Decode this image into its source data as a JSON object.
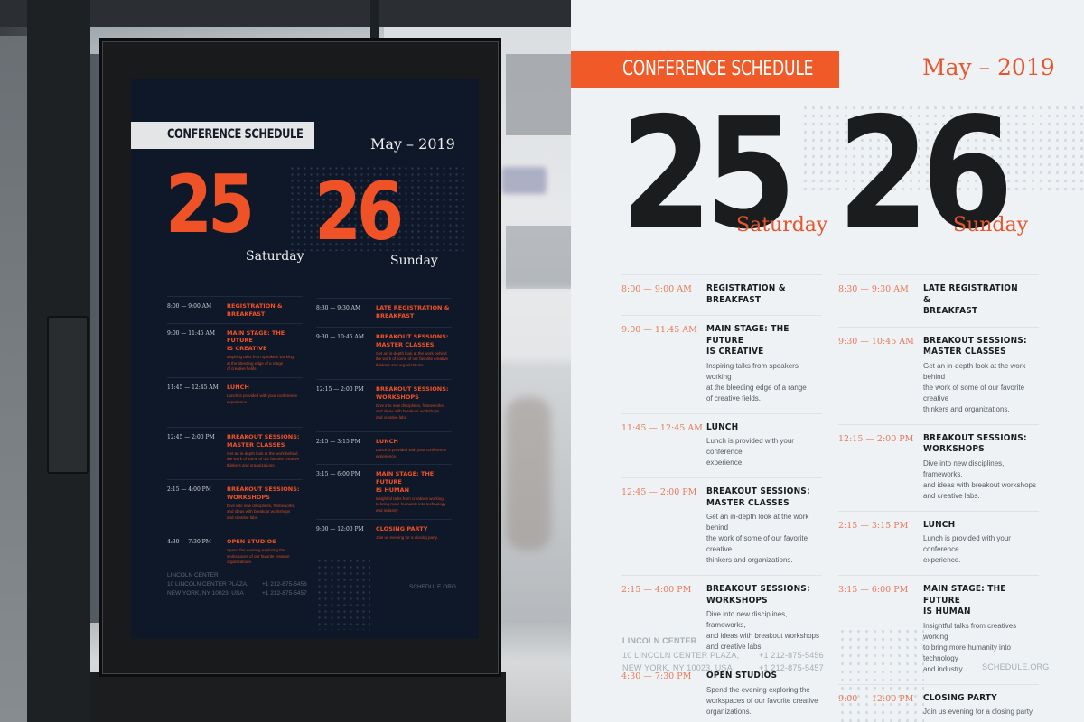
{
  "poster": {
    "title": "CONFERENCE SCHEDULE",
    "month_year": "May – 2019",
    "days": [
      {
        "number": "25",
        "name": "Saturday",
        "events": [
          {
            "time": "8:00 — 9:00 AM",
            "title": "REGISTRATION & BREAKFAST",
            "description": ""
          },
          {
            "time": "9:00 — 11:45 AM",
            "title": "MAIN STAGE: THE FUTURE\nIS CREATIVE",
            "description": "Inspiring talks from speakers working\nat the bleeding edge of a range\nof creative fields."
          },
          {
            "time": "11:45 — 12:45 AM",
            "title": "LUNCH",
            "description": "Lunch is provided with your conference\nexperience."
          },
          {
            "time": "12:45 — 2:00 PM",
            "title": "BREAKOUT SESSIONS:\nMASTER CLASSES",
            "description": "Get an in-depth look at the work behind\nthe work of some of our favorite creative\nthinkers and organizations."
          },
          {
            "time": "2:15 — 4:00 PM",
            "title": "BREAKOUT SESSIONS:\nWORKSHOPS",
            "description": "Dive into new disciplines, frameworks,\nand ideas with breakout workshops\nand creative labs."
          },
          {
            "time": "4:30 — 7:30 PM",
            "title": "OPEN STUDIOS",
            "description": "Spend the evening exploring the\nworkspaces of our favorite creative\norganizations."
          }
        ]
      },
      {
        "number": "26",
        "name": "Sunday",
        "events": [
          {
            "time": "8:30 — 9:30 AM",
            "title": "LATE REGISTRATION &\nBREAKFAST",
            "description": ""
          },
          {
            "time": "9:30 — 10:45 AM",
            "title": "BREAKOUT SESSIONS:\nMASTER CLASSES",
            "description": "Get an in-depth look at the work behind\nthe work of some of our favorite creative\nthinkers and organizations."
          },
          {
            "time": "12:15 — 2:00 PM",
            "title": "BREAKOUT SESSIONS:\nWORKSHOPS",
            "description": "Dive into new disciplines, frameworks,\nand ideas with breakout workshops\nand creative labs."
          },
          {
            "time": "2:15 — 3:15 PM",
            "title": "LUNCH",
            "description": "Lunch is provided with your conference\nexperience."
          },
          {
            "time": "3:15 — 6:00 PM",
            "title": "MAIN STAGE: THE FUTURE\nIS HUMAN",
            "description": "Insightful talks from creatives working\nto bring more humanity into technology\nand industry."
          },
          {
            "time": "9:00 — 12:00 PM",
            "title": "CLOSING PARTY",
            "description": "Join us evening for a closing party."
          }
        ]
      }
    ],
    "footer": {
      "venue": "LINCOLN CENTER",
      "address_line1": "10 LINCOLN CENTER PLAZA,",
      "address_line2": "NEW YORK, NY 10023, USA",
      "phone1": "+1 212-875-5456",
      "phone2": "+1 212-875-5457",
      "website": "SCHEDULE.ORG"
    }
  },
  "colors": {
    "accent": "#f05a28",
    "dark_text": "#1b1c1e",
    "light_bg": "#eef2f5",
    "navy_bg": "#0f1828",
    "muted": "#a5adb4"
  }
}
